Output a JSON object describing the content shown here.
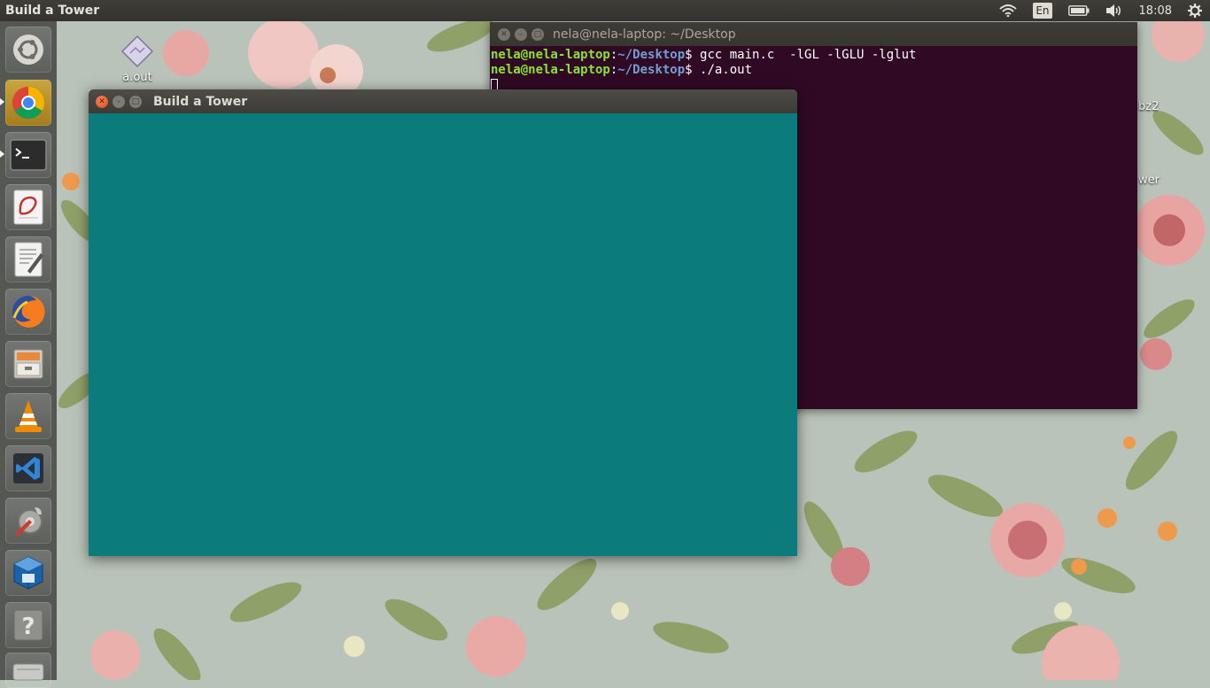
{
  "top_panel": {
    "active_app_title": "Build a Tower",
    "keyboard_layout": "En",
    "clock": "18:08",
    "icons": [
      "wifi-icon",
      "keyboard-icon",
      "battery-icon",
      "volume-icon",
      "settings-gear-icon"
    ]
  },
  "launcher": {
    "items": [
      {
        "name": "ubuntu-dash",
        "icon": "ubuntu-logo-icon",
        "running": false
      },
      {
        "name": "chrome",
        "icon": "chrome-icon",
        "running": true
      },
      {
        "name": "terminal",
        "icon": "terminal-icon",
        "running": true
      },
      {
        "name": "pdf-viewer",
        "icon": "pdf-reader-icon",
        "running": false
      },
      {
        "name": "text-editor",
        "icon": "text-editor-icon",
        "running": false
      },
      {
        "name": "firefox",
        "icon": "firefox-icon",
        "running": false
      },
      {
        "name": "files",
        "icon": "file-cabinet-icon",
        "running": false
      },
      {
        "name": "vlc",
        "icon": "vlc-cone-icon",
        "running": false
      },
      {
        "name": "vscode",
        "icon": "vscode-icon",
        "running": false
      },
      {
        "name": "system-settings",
        "icon": "system-tools-icon",
        "running": false
      },
      {
        "name": "virtualbox",
        "icon": "virtualbox-icon",
        "running": false
      },
      {
        "name": "help",
        "icon": "help-question-icon",
        "running": false
      },
      {
        "name": "drive",
        "icon": "drive-icon",
        "running": false
      }
    ]
  },
  "desktop": {
    "icons": [
      {
        "label": "a.out",
        "icon": "executable-file-icon"
      }
    ],
    "partial_labels": [
      "bz2",
      "wer"
    ]
  },
  "terminal": {
    "title": "nela@nela-laptop: ~/Desktop",
    "lines": [
      {
        "user": "nela@nela-laptop",
        "sep": ":",
        "path": "~/Desktop",
        "prompt": "$ ",
        "command": "gcc main.c  -lGL -lGLU -lglut"
      },
      {
        "user": "nela@nela-laptop",
        "sep": ":",
        "path": "~/Desktop",
        "prompt": "$ ",
        "command": "./a.out"
      }
    ]
  },
  "game_window": {
    "title": "Build a Tower",
    "canvas_color": "#0b7b7b"
  },
  "colors": {
    "terminal_bg": "#300a24",
    "prompt_user": "#8ae234",
    "prompt_path": "#729fcf",
    "game_canvas": "#0b7b7b",
    "close_button": "#df4a16"
  }
}
